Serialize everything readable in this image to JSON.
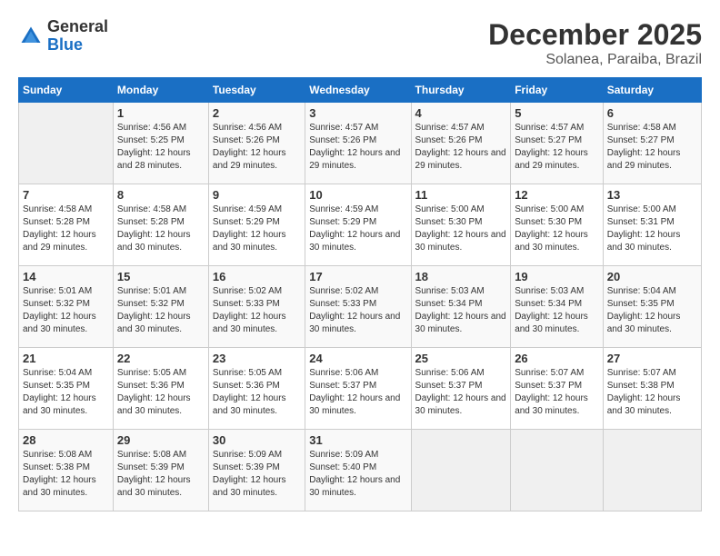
{
  "header": {
    "logo_general": "General",
    "logo_blue": "Blue",
    "month": "December 2025",
    "location": "Solanea, Paraiba, Brazil"
  },
  "days_of_week": [
    "Sunday",
    "Monday",
    "Tuesday",
    "Wednesday",
    "Thursday",
    "Friday",
    "Saturday"
  ],
  "weeks": [
    [
      {
        "day": "",
        "sunrise": "",
        "sunset": "",
        "daylight": ""
      },
      {
        "day": "1",
        "sunrise": "Sunrise: 4:56 AM",
        "sunset": "Sunset: 5:25 PM",
        "daylight": "Daylight: 12 hours and 28 minutes."
      },
      {
        "day": "2",
        "sunrise": "Sunrise: 4:56 AM",
        "sunset": "Sunset: 5:26 PM",
        "daylight": "Daylight: 12 hours and 29 minutes."
      },
      {
        "day": "3",
        "sunrise": "Sunrise: 4:57 AM",
        "sunset": "Sunset: 5:26 PM",
        "daylight": "Daylight: 12 hours and 29 minutes."
      },
      {
        "day": "4",
        "sunrise": "Sunrise: 4:57 AM",
        "sunset": "Sunset: 5:26 PM",
        "daylight": "Daylight: 12 hours and 29 minutes."
      },
      {
        "day": "5",
        "sunrise": "Sunrise: 4:57 AM",
        "sunset": "Sunset: 5:27 PM",
        "daylight": "Daylight: 12 hours and 29 minutes."
      },
      {
        "day": "6",
        "sunrise": "Sunrise: 4:58 AM",
        "sunset": "Sunset: 5:27 PM",
        "daylight": "Daylight: 12 hours and 29 minutes."
      }
    ],
    [
      {
        "day": "7",
        "sunrise": "Sunrise: 4:58 AM",
        "sunset": "Sunset: 5:28 PM",
        "daylight": "Daylight: 12 hours and 29 minutes."
      },
      {
        "day": "8",
        "sunrise": "Sunrise: 4:58 AM",
        "sunset": "Sunset: 5:28 PM",
        "daylight": "Daylight: 12 hours and 30 minutes."
      },
      {
        "day": "9",
        "sunrise": "Sunrise: 4:59 AM",
        "sunset": "Sunset: 5:29 PM",
        "daylight": "Daylight: 12 hours and 30 minutes."
      },
      {
        "day": "10",
        "sunrise": "Sunrise: 4:59 AM",
        "sunset": "Sunset: 5:29 PM",
        "daylight": "Daylight: 12 hours and 30 minutes."
      },
      {
        "day": "11",
        "sunrise": "Sunrise: 5:00 AM",
        "sunset": "Sunset: 5:30 PM",
        "daylight": "Daylight: 12 hours and 30 minutes."
      },
      {
        "day": "12",
        "sunrise": "Sunrise: 5:00 AM",
        "sunset": "Sunset: 5:30 PM",
        "daylight": "Daylight: 12 hours and 30 minutes."
      },
      {
        "day": "13",
        "sunrise": "Sunrise: 5:00 AM",
        "sunset": "Sunset: 5:31 PM",
        "daylight": "Daylight: 12 hours and 30 minutes."
      }
    ],
    [
      {
        "day": "14",
        "sunrise": "Sunrise: 5:01 AM",
        "sunset": "Sunset: 5:32 PM",
        "daylight": "Daylight: 12 hours and 30 minutes."
      },
      {
        "day": "15",
        "sunrise": "Sunrise: 5:01 AM",
        "sunset": "Sunset: 5:32 PM",
        "daylight": "Daylight: 12 hours and 30 minutes."
      },
      {
        "day": "16",
        "sunrise": "Sunrise: 5:02 AM",
        "sunset": "Sunset: 5:33 PM",
        "daylight": "Daylight: 12 hours and 30 minutes."
      },
      {
        "day": "17",
        "sunrise": "Sunrise: 5:02 AM",
        "sunset": "Sunset: 5:33 PM",
        "daylight": "Daylight: 12 hours and 30 minutes."
      },
      {
        "day": "18",
        "sunrise": "Sunrise: 5:03 AM",
        "sunset": "Sunset: 5:34 PM",
        "daylight": "Daylight: 12 hours and 30 minutes."
      },
      {
        "day": "19",
        "sunrise": "Sunrise: 5:03 AM",
        "sunset": "Sunset: 5:34 PM",
        "daylight": "Daylight: 12 hours and 30 minutes."
      },
      {
        "day": "20",
        "sunrise": "Sunrise: 5:04 AM",
        "sunset": "Sunset: 5:35 PM",
        "daylight": "Daylight: 12 hours and 30 minutes."
      }
    ],
    [
      {
        "day": "21",
        "sunrise": "Sunrise: 5:04 AM",
        "sunset": "Sunset: 5:35 PM",
        "daylight": "Daylight: 12 hours and 30 minutes."
      },
      {
        "day": "22",
        "sunrise": "Sunrise: 5:05 AM",
        "sunset": "Sunset: 5:36 PM",
        "daylight": "Daylight: 12 hours and 30 minutes."
      },
      {
        "day": "23",
        "sunrise": "Sunrise: 5:05 AM",
        "sunset": "Sunset: 5:36 PM",
        "daylight": "Daylight: 12 hours and 30 minutes."
      },
      {
        "day": "24",
        "sunrise": "Sunrise: 5:06 AM",
        "sunset": "Sunset: 5:37 PM",
        "daylight": "Daylight: 12 hours and 30 minutes."
      },
      {
        "day": "25",
        "sunrise": "Sunrise: 5:06 AM",
        "sunset": "Sunset: 5:37 PM",
        "daylight": "Daylight: 12 hours and 30 minutes."
      },
      {
        "day": "26",
        "sunrise": "Sunrise: 5:07 AM",
        "sunset": "Sunset: 5:37 PM",
        "daylight": "Daylight: 12 hours and 30 minutes."
      },
      {
        "day": "27",
        "sunrise": "Sunrise: 5:07 AM",
        "sunset": "Sunset: 5:38 PM",
        "daylight": "Daylight: 12 hours and 30 minutes."
      }
    ],
    [
      {
        "day": "28",
        "sunrise": "Sunrise: 5:08 AM",
        "sunset": "Sunset: 5:38 PM",
        "daylight": "Daylight: 12 hours and 30 minutes."
      },
      {
        "day": "29",
        "sunrise": "Sunrise: 5:08 AM",
        "sunset": "Sunset: 5:39 PM",
        "daylight": "Daylight: 12 hours and 30 minutes."
      },
      {
        "day": "30",
        "sunrise": "Sunrise: 5:09 AM",
        "sunset": "Sunset: 5:39 PM",
        "daylight": "Daylight: 12 hours and 30 minutes."
      },
      {
        "day": "31",
        "sunrise": "Sunrise: 5:09 AM",
        "sunset": "Sunset: 5:40 PM",
        "daylight": "Daylight: 12 hours and 30 minutes."
      },
      {
        "day": "",
        "sunrise": "",
        "sunset": "",
        "daylight": ""
      },
      {
        "day": "",
        "sunrise": "",
        "sunset": "",
        "daylight": ""
      },
      {
        "day": "",
        "sunrise": "",
        "sunset": "",
        "daylight": ""
      }
    ]
  ]
}
